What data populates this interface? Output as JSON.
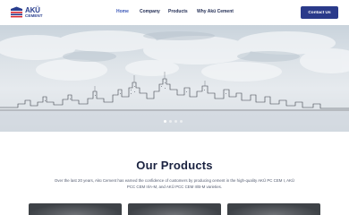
{
  "header": {
    "logo": {
      "line1": "AKÜ",
      "line2": "CEMENT"
    },
    "nav": [
      {
        "label": "Home",
        "active": true
      },
      {
        "label": "Company",
        "active": false
      },
      {
        "label": "Products",
        "active": false
      },
      {
        "label": "Why Akü Cement",
        "active": false
      }
    ],
    "contact_label": "Contact Us"
  },
  "hero": {
    "slide_count": 4,
    "active_slide": 1
  },
  "products": {
    "title": "Our Products",
    "description": "Over the last 20 years, Akü Cement has earned the confidence of customers by producing cement in the high-quality AKÜ PC CEM I, AKÜ PCC CEM II/A-M, and AKÜ PCC CEM II/B-M varieties."
  },
  "colors": {
    "brand": "#2a3a8a",
    "accent": "#3c58b8",
    "logo_red": "#d8262f"
  }
}
